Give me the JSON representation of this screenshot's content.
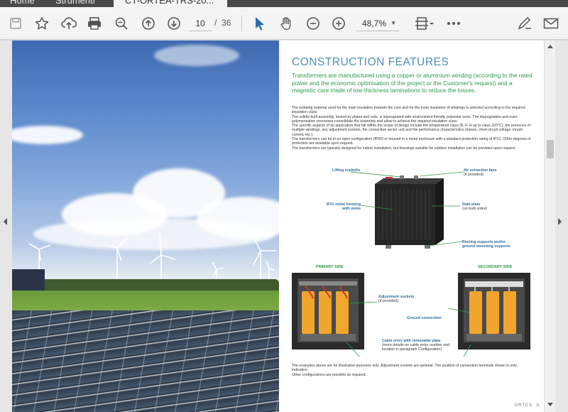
{
  "tabs": [
    {
      "label": "Home"
    },
    {
      "label": "Strumenti"
    },
    {
      "label": "CT-ORTEA-TRS-20..."
    }
  ],
  "toolbar": {
    "page_current": "10",
    "page_separator": "/",
    "page_total": "36",
    "zoom": "48,7%"
  },
  "icons": {
    "save": "save-icon",
    "bookmark": "star-icon",
    "upload": "cloud-upload-icon",
    "print": "printer-icon",
    "zoom_search": "magnifier-icon",
    "prev": "arrow-up-circle-icon",
    "next": "arrow-down-circle-icon",
    "select": "cursor-arrow-icon",
    "hand": "hand-icon",
    "zoom_out": "minus-circle-icon",
    "zoom_in": "plus-circle-icon",
    "fit": "page-fit-icon",
    "more": "more-dots-icon",
    "sign": "pen-sign-icon",
    "mail": "envelope-icon"
  },
  "colors": {
    "accent_blue": "#2d6cb5",
    "title_blue": "#4e8fb7",
    "lead_green": "#2f9a4b",
    "label_blue": "#2d6e9e"
  },
  "document": {
    "title": "CONSTRUCTION FEATURES",
    "lead": "Transformers are manufactured using a copper or aluminium winding (according to the rated power and the economic optimisation of the project or the Customer's request) and a magnetic core made of low-thickness laminations to reduce the losses.",
    "body": [
      "The isolating material used for the main insulation towards the core and for the inner insulation of windings is selected according to the required insulation class.",
      "The solidly-built assembly, locked by plates and rods, is impregnated with environment friendly polyester resin. The impregnation and oven polymerisation processes consolidate the assembly and allow to achieve the required insulation class.",
      "The specific aspects of an application that fall within the scope of design include the temperature class (B, F, H up to class 220°C), the presence of multiple windings, any adjustment sockets, the connection sector unit and the performance characteristics (losses, short-circuit voltage, inrush current, etc.).",
      "The transformers can be in an open configuration (IP00) or housed in a metal enclosure with a standard protection rating of IP21. Other degrees of protection are available upon request.",
      "The transformers are typically designed for indoor installation, but housings suitable for outdoor installation can be provided upon request."
    ],
    "labels": {
      "lifting": "Lifting eyebolts",
      "air": "Air extraction fans",
      "air_sub": "(if provided)",
      "housing": "IP21 metal housing",
      "housing2": "with vents",
      "data": "Data plate",
      "data_sub": "(on both sides)",
      "resting": "Resting supports and/or",
      "resting2": "ground mounting supports",
      "primary": "PRIMARY SIDE",
      "secondary": "SECONDARY SIDE",
      "adjust": "Adjustment sockets",
      "adjust_sub": "(if provided)",
      "ground": "Ground connection",
      "cable": "Cable entry with removable plate",
      "cable_sub1": "(more details on cable entry number and",
      "cable_sub2": "location in paragraph Configuration)"
    },
    "footer": [
      "The examples above are for illustrative purposes only. Adjustment sockets are optional. The position of connection terminals shown is only indicative.",
      "Other configurations are possible as required."
    ],
    "brand": "ORTEA",
    "page_number": "11"
  }
}
